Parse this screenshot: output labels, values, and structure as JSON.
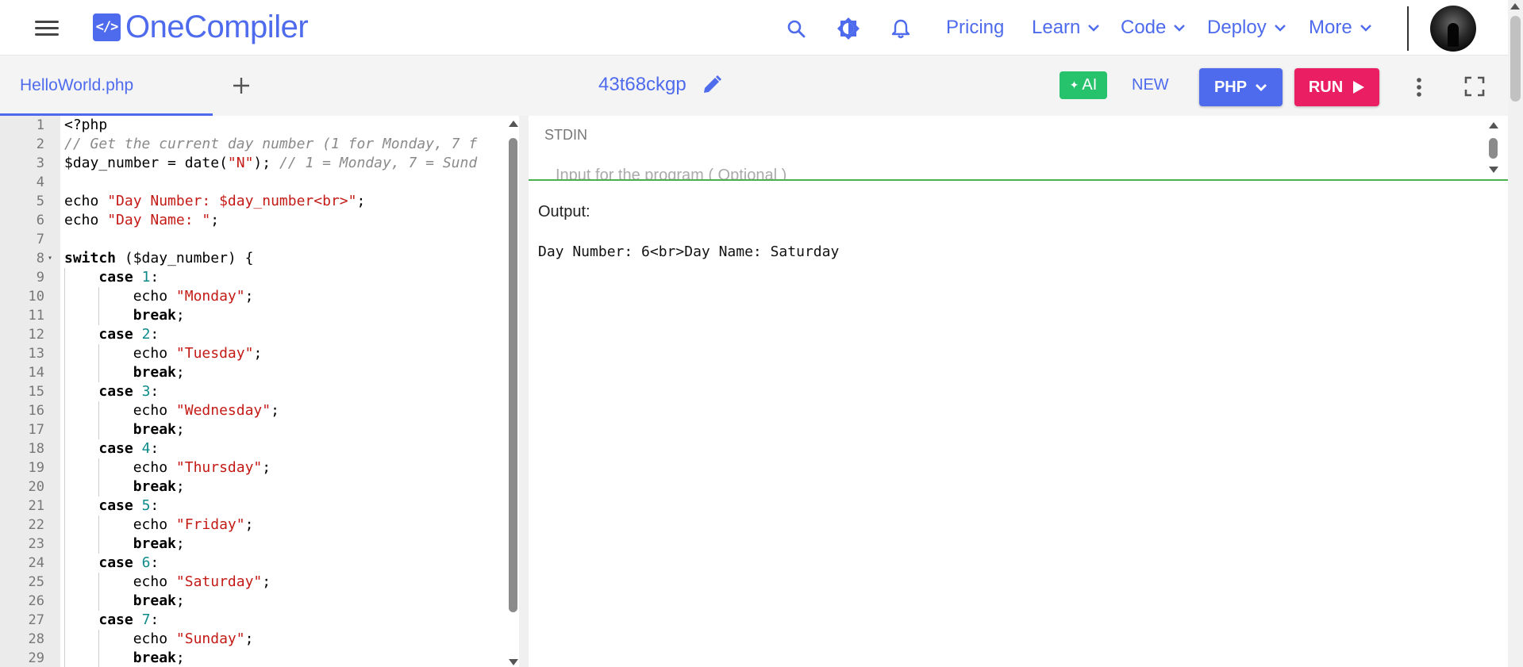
{
  "nav": {
    "logo_badge": "</>",
    "logo_text": "OneCompiler",
    "links": [
      {
        "label": "Pricing"
      },
      {
        "label": "Learn"
      },
      {
        "label": "Code"
      },
      {
        "label": "Deploy"
      },
      {
        "label": "More"
      }
    ],
    "icons": [
      "menu-icon",
      "search-icon",
      "theme-toggle-icon",
      "bell-icon"
    ]
  },
  "toolbar": {
    "file_tab": "HelloWorld.php",
    "project_name": "43t68ckgp",
    "ai_label": "AI",
    "new_label": "NEW",
    "language_label": "PHP",
    "run_label": "RUN"
  },
  "editor": {
    "lines": [
      {
        "n": "1",
        "html": "&lt;?php"
      },
      {
        "n": "2",
        "html": "<span class=\"t-cmt\">// Get the current day number (1 for Monday, 7 f</span>"
      },
      {
        "n": "3",
        "html": "$day_number = date(<span class=\"t-str\">\"N\"</span>); <span class=\"t-cmt\">// 1 = Monday, 7 = Sund</span>"
      },
      {
        "n": "4",
        "html": ""
      },
      {
        "n": "5",
        "html": "echo <span class=\"t-str\">\"Day Number: $day_number&lt;br&gt;\"</span>;"
      },
      {
        "n": "6",
        "html": "echo <span class=\"t-str\">\"Day Name: \"</span>;"
      },
      {
        "n": "7",
        "html": ""
      },
      {
        "n": "8",
        "html": "<span class=\"t-kw\">switch</span> ($day_number) {",
        "fold": true
      },
      {
        "n": "9",
        "html": "    <span class=\"t-kw\">case</span> <span class=\"t-num\">1</span>:",
        "guides": 1
      },
      {
        "n": "10",
        "html": "        echo <span class=\"t-str\">\"Monday\"</span>;",
        "guides": 2
      },
      {
        "n": "11",
        "html": "        <span class=\"t-kw\">break</span>;",
        "guides": 2
      },
      {
        "n": "12",
        "html": "    <span class=\"t-kw\">case</span> <span class=\"t-num\">2</span>:",
        "guides": 1
      },
      {
        "n": "13",
        "html": "        echo <span class=\"t-str\">\"Tuesday\"</span>;",
        "guides": 2
      },
      {
        "n": "14",
        "html": "        <span class=\"t-kw\">break</span>;",
        "guides": 2
      },
      {
        "n": "15",
        "html": "    <span class=\"t-kw\">case</span> <span class=\"t-num\">3</span>:",
        "guides": 1
      },
      {
        "n": "16",
        "html": "        echo <span class=\"t-str\">\"Wednesday\"</span>;",
        "guides": 2
      },
      {
        "n": "17",
        "html": "        <span class=\"t-kw\">break</span>;",
        "guides": 2
      },
      {
        "n": "18",
        "html": "    <span class=\"t-kw\">case</span> <span class=\"t-num\">4</span>:",
        "guides": 1
      },
      {
        "n": "19",
        "html": "        echo <span class=\"t-str\">\"Thursday\"</span>;",
        "guides": 2
      },
      {
        "n": "20",
        "html": "        <span class=\"t-kw\">break</span>;",
        "guides": 2
      },
      {
        "n": "21",
        "html": "    <span class=\"t-kw\">case</span> <span class=\"t-num\">5</span>:",
        "guides": 1
      },
      {
        "n": "22",
        "html": "        echo <span class=\"t-str\">\"Friday\"</span>;",
        "guides": 2
      },
      {
        "n": "23",
        "html": "        <span class=\"t-kw\">break</span>;",
        "guides": 2
      },
      {
        "n": "24",
        "html": "    <span class=\"t-kw\">case</span> <span class=\"t-num\">6</span>:",
        "guides": 1
      },
      {
        "n": "25",
        "html": "        echo <span class=\"t-str\">\"Saturday\"</span>;",
        "guides": 2
      },
      {
        "n": "26",
        "html": "        <span class=\"t-kw\">break</span>;",
        "guides": 2
      },
      {
        "n": "27",
        "html": "    <span class=\"t-kw\">case</span> <span class=\"t-num\">7</span>:",
        "guides": 1
      },
      {
        "n": "28",
        "html": "        echo <span class=\"t-str\">\"Sunday\"</span>;",
        "guides": 2
      },
      {
        "n": "29",
        "html": "        <span class=\"t-kw\">break</span>;",
        "guides": 2
      }
    ]
  },
  "stdin": {
    "label": "STDIN",
    "placeholder": "Input for the program ( Optional )"
  },
  "output": {
    "label": "Output:",
    "text": "Day Number: 6<br>Day Name: Saturday"
  },
  "colors": {
    "brand": "#4f6bed",
    "run": "#e91e63",
    "ai": "#27c26c",
    "stdin_border": "#4caf50"
  }
}
